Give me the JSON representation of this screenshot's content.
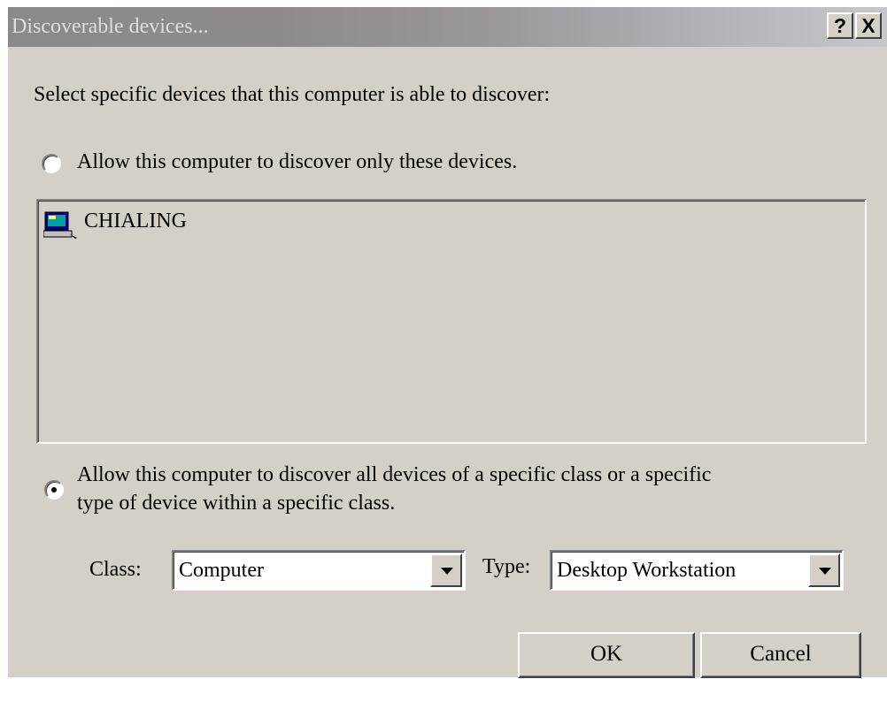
{
  "window": {
    "title": "Discoverable devices...",
    "help_label": "?",
    "close_label": "X"
  },
  "instruction": "Select specific devices that this computer is able to discover:",
  "option_specific": {
    "label": "Allow this computer to discover only these devices.",
    "selected": false
  },
  "device_list": {
    "items": [
      {
        "icon": "computer-icon",
        "label": "CHIALING"
      }
    ]
  },
  "option_class": {
    "label_line1": "Allow this computer to discover all devices of a specific class or a specific",
    "label_line2": "type of device within a specific class.",
    "selected": true
  },
  "class_field": {
    "label": "Class:",
    "value": "Computer"
  },
  "type_field": {
    "label": "Type:",
    "value": "Desktop Workstation"
  },
  "buttons": {
    "ok": "OK",
    "cancel": "Cancel"
  },
  "colors": {
    "dialog_face": "#d4d0c8",
    "titlebar_inactive": "#8a8a8a",
    "title_text": "#dedede"
  }
}
